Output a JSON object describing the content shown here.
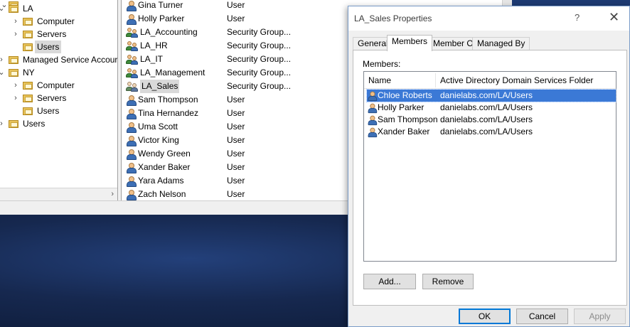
{
  "tree": {
    "items": [
      {
        "label": "LA",
        "chevron": "⌄",
        "indent": 0
      },
      {
        "label": "Computer",
        "chevron": "›",
        "indent": 1
      },
      {
        "label": "Servers",
        "chevron": "›",
        "indent": 1
      },
      {
        "label": "Users",
        "chevron": "",
        "indent": 1,
        "selected": true
      },
      {
        "label": "Managed Service Accour",
        "chevron": "›",
        "indent": 0
      },
      {
        "label": "NY",
        "chevron": "⌄",
        "indent": 0
      },
      {
        "label": "Computer",
        "chevron": "›",
        "indent": 1
      },
      {
        "label": "Servers",
        "chevron": "›",
        "indent": 1
      },
      {
        "label": "Users",
        "chevron": "",
        "indent": 1
      },
      {
        "label": "Users",
        "chevron": "›",
        "indent": 0
      }
    ],
    "scroll_arrow": "›"
  },
  "list": {
    "rows": [
      {
        "name": "Gina Turner",
        "type": "User",
        "kind": "user"
      },
      {
        "name": "Holly Parker",
        "type": "User",
        "kind": "user"
      },
      {
        "name": "LA_Accounting",
        "type": "Security Group...",
        "kind": "group"
      },
      {
        "name": "LA_HR",
        "type": "Security Group...",
        "kind": "group"
      },
      {
        "name": "LA_IT",
        "type": "Security Group...",
        "kind": "group"
      },
      {
        "name": "LA_Management",
        "type": "Security Group...",
        "kind": "group"
      },
      {
        "name": "LA_Sales",
        "type": "Security Group...",
        "kind": "group-selected"
      },
      {
        "name": "Sam Thompson",
        "type": "User",
        "kind": "user"
      },
      {
        "name": "Tina Hernandez",
        "type": "User",
        "kind": "user"
      },
      {
        "name": "Uma Scott",
        "type": "User",
        "kind": "user"
      },
      {
        "name": "Victor King",
        "type": "User",
        "kind": "user"
      },
      {
        "name": "Wendy Green",
        "type": "User",
        "kind": "user"
      },
      {
        "name": "Xander Baker",
        "type": "User",
        "kind": "user"
      },
      {
        "name": "Yara Adams",
        "type": "User",
        "kind": "user"
      },
      {
        "name": "Zach Nelson",
        "type": "User",
        "kind": "user"
      }
    ]
  },
  "dialog": {
    "title": "LA_Sales Properties",
    "help": "?",
    "close": "✕",
    "tabs": [
      {
        "label": "General"
      },
      {
        "label": "Members",
        "active": true
      },
      {
        "label": "Member Of"
      },
      {
        "label": "Managed By"
      }
    ],
    "members_label": "Members:",
    "columns": {
      "name": "Name",
      "folder": "Active Directory Domain Services Folder"
    },
    "members": [
      {
        "name": "Chloe Roberts",
        "folder": "danielabs.com/LA/Users",
        "selected": true
      },
      {
        "name": "Holly Parker",
        "folder": "danielabs.com/LA/Users"
      },
      {
        "name": "Sam Thompson",
        "folder": "danielabs.com/LA/Users"
      },
      {
        "name": "Xander Baker",
        "folder": "danielabs.com/LA/Users"
      }
    ],
    "add_label": "Add...",
    "remove_label": "Remove",
    "ok_label": "OK",
    "cancel_label": "Cancel",
    "apply_label": "Apply"
  }
}
